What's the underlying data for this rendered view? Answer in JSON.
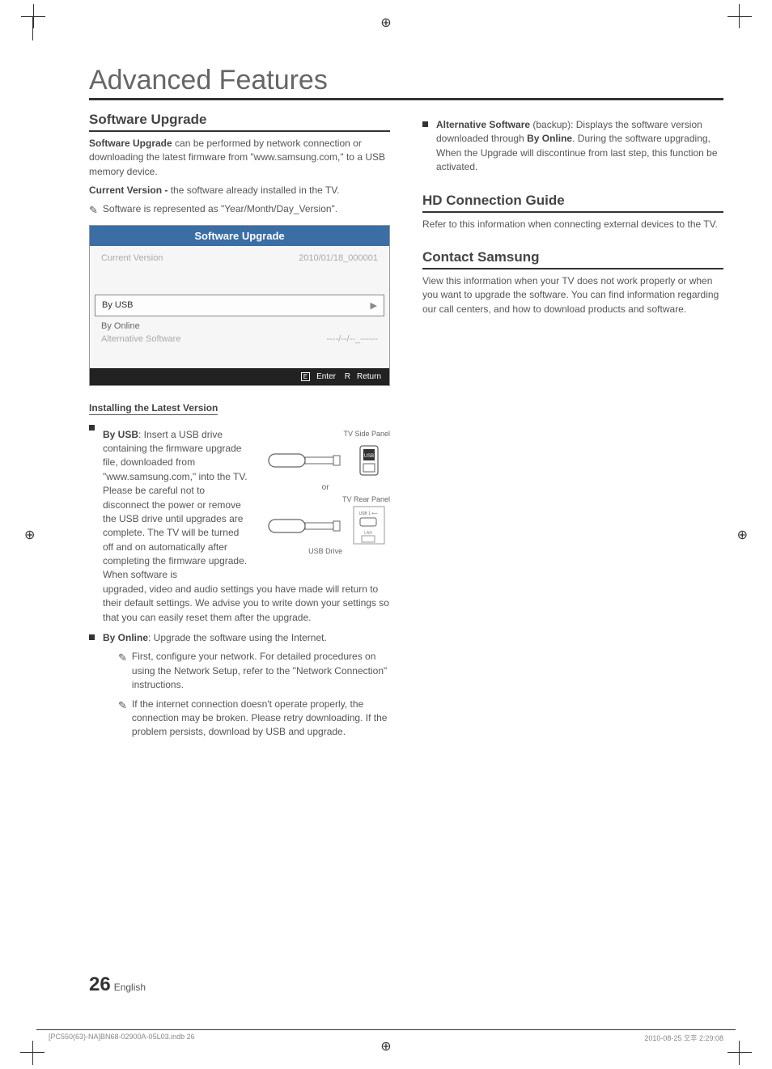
{
  "title": "Advanced Features",
  "left": {
    "section1_heading": "Software Upgrade",
    "section1_intro_bold": "Software Upgrade",
    "section1_intro_rest": " can be performed  by network connection or downloading the latest firmware from \"www.samsung.com,\" to a USB memory device.",
    "current_version_bold": "Current Version -",
    "current_version_rest": " the software already installed in the TV.",
    "note1": "Software is represented as \"Year/Month/Day_Version\".",
    "ui": {
      "title": "Software Upgrade",
      "rows": {
        "current_version_label": "Current Version",
        "current_version_value": "2010/01/18_000001",
        "by_usb": "By USB",
        "by_online": "By Online",
        "alt_label": "Alternative Software",
        "alt_value": "----/--/--_------"
      },
      "footer_enter_icon": "E",
      "footer_enter": "Enter",
      "footer_return_icon": "R",
      "footer_return": "Return"
    },
    "installing_subhead": "Installing the Latest Version",
    "by_usb_bold": "By USB",
    "by_usb_text_start": ": Insert a USB drive containing the firmware upgrade file, downloaded from \"www.samsung.com,\" into the TV. Please be careful not to disconnect the power or remove the USB drive until upgrades are complete. The TV will be turned off and on automatically after completing the firmware upgrade. When software is",
    "by_usb_text_cont": "upgraded, video and audio settings you have made will return to their default settings. We advise you to write down your settings so that you can easily reset them after the upgrade.",
    "diagram": {
      "tv_side": "TV Side Panel",
      "or": "or",
      "tv_rear": "TV Rear Panel",
      "usb_drive": "USB Drive"
    },
    "by_online_bold": "By Online",
    "by_online_text": ": Upgrade the software using the Internet.",
    "by_online_note1": "First, configure your network. For detailed procedures on using the Network Setup, refer to the \"Network Connection\" instructions.",
    "by_online_note2": "If the internet connection doesn't operate properly, the connection may be broken. Please retry downloading. If the problem persists, download by USB and upgrade."
  },
  "right": {
    "alt_bold": "Alternative Software",
    "alt_text_1": " (backup): Displays the software version downloaded through ",
    "alt_bold2": "By Online",
    "alt_text_2": ". During the software upgrading, When the Upgrade will discontinue from last step, this function be activated.",
    "hd_heading": "HD Connection Guide",
    "hd_text": "Refer to this information when connecting external devices to the TV.",
    "contact_heading": "Contact Samsung",
    "contact_text": "View this information when your TV does not work properly or when you want to upgrade the software. You can find information regarding our call centers, and how to download products and software."
  },
  "footer": {
    "page_num": "26",
    "page_lang": "English",
    "file": "[PC550(63)-NA]BN68-02900A-05L03.indb   26",
    "timestamp": "2010-08-25   오후 2:29:08"
  }
}
